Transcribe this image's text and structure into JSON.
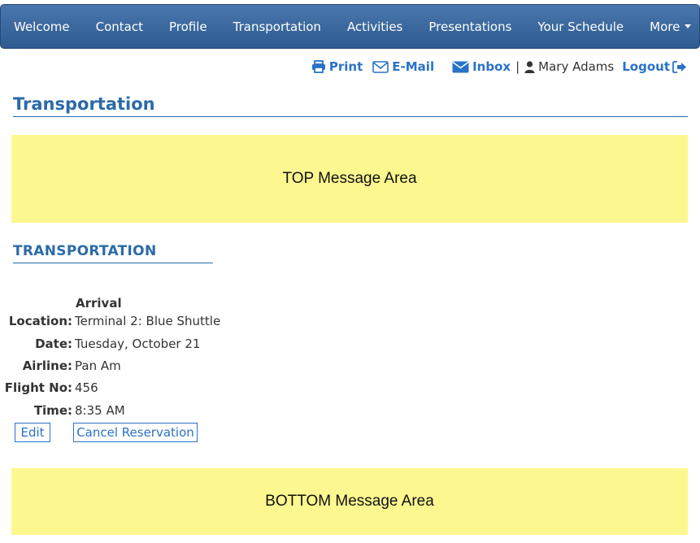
{
  "nav": {
    "items": [
      {
        "label": "Welcome"
      },
      {
        "label": "Contact"
      },
      {
        "label": "Profile"
      },
      {
        "label": "Transportation",
        "active": true
      },
      {
        "label": "Activities"
      },
      {
        "label": "Presentations"
      },
      {
        "label": "Your Schedule"
      },
      {
        "label": "More"
      }
    ]
  },
  "utility": {
    "print_label": "Print",
    "email_label": "E-Mail",
    "inbox_label": "Inbox",
    "separator": "|",
    "user_name": "Mary Adams",
    "logout_label": "Logout"
  },
  "page": {
    "title": "Transportation"
  },
  "messages": {
    "top": "TOP Message Area",
    "bottom": "BOTTOM Message Area"
  },
  "section": {
    "title": "TRANSPORTATION",
    "heading": "Arrival",
    "fields": [
      {
        "label": "Location:",
        "value": "Terminal 2: Blue Shuttle"
      },
      {
        "label": "Date:",
        "value": "Tuesday, October 21"
      },
      {
        "label": "Airline:",
        "value": "Pan Am"
      },
      {
        "label": "Flight No:",
        "value": "456"
      },
      {
        "label": "Time:",
        "value": "8:35 AM"
      }
    ],
    "edit_label": "Edit",
    "cancel_label": "Cancel Reservation"
  },
  "colors": {
    "nav_bg": "#3b6a9e",
    "link": "#2a72c7",
    "title": "#2b6aa8",
    "message_bg": "#fdf78f"
  }
}
